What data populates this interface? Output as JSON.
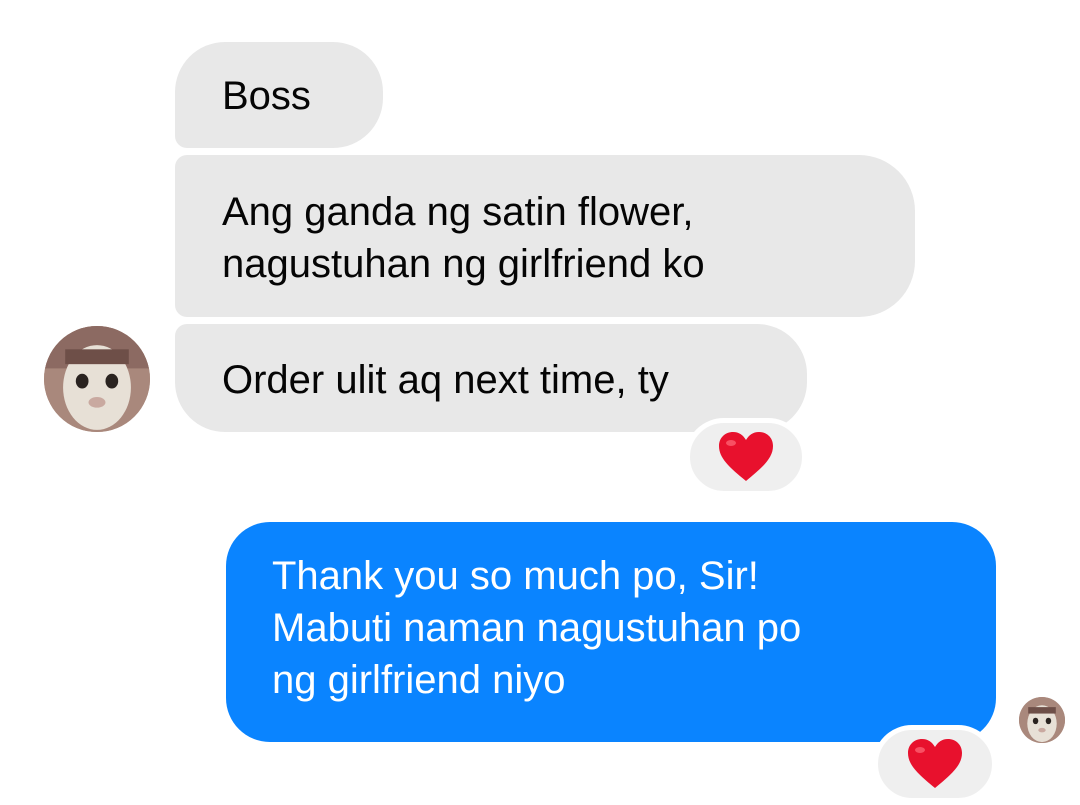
{
  "conversation": {
    "incoming": [
      {
        "lines": [
          "Boss"
        ]
      },
      {
        "lines": [
          "Ang ganda ng satin flower,",
          "nagustuhan ng girlfriend ko"
        ]
      },
      {
        "lines": [
          "Order ulit aq next time, ty"
        ]
      }
    ],
    "outgoing": [
      {
        "lines": [
          "Thank you so much po, Sir!",
          "Mabuti naman nagustuhan po",
          "ng girlfriend niyo"
        ]
      }
    ],
    "reactions": [
      {
        "on": "incoming-3",
        "icon": "red-heart-icon"
      },
      {
        "on": "outgoing-1",
        "icon": "red-heart-icon"
      }
    ]
  },
  "colors": {
    "incoming_bubble": "#e8e8e8",
    "outgoing_bubble": "#0a84ff",
    "heart": "#e8112d",
    "background": "#ffffff"
  }
}
